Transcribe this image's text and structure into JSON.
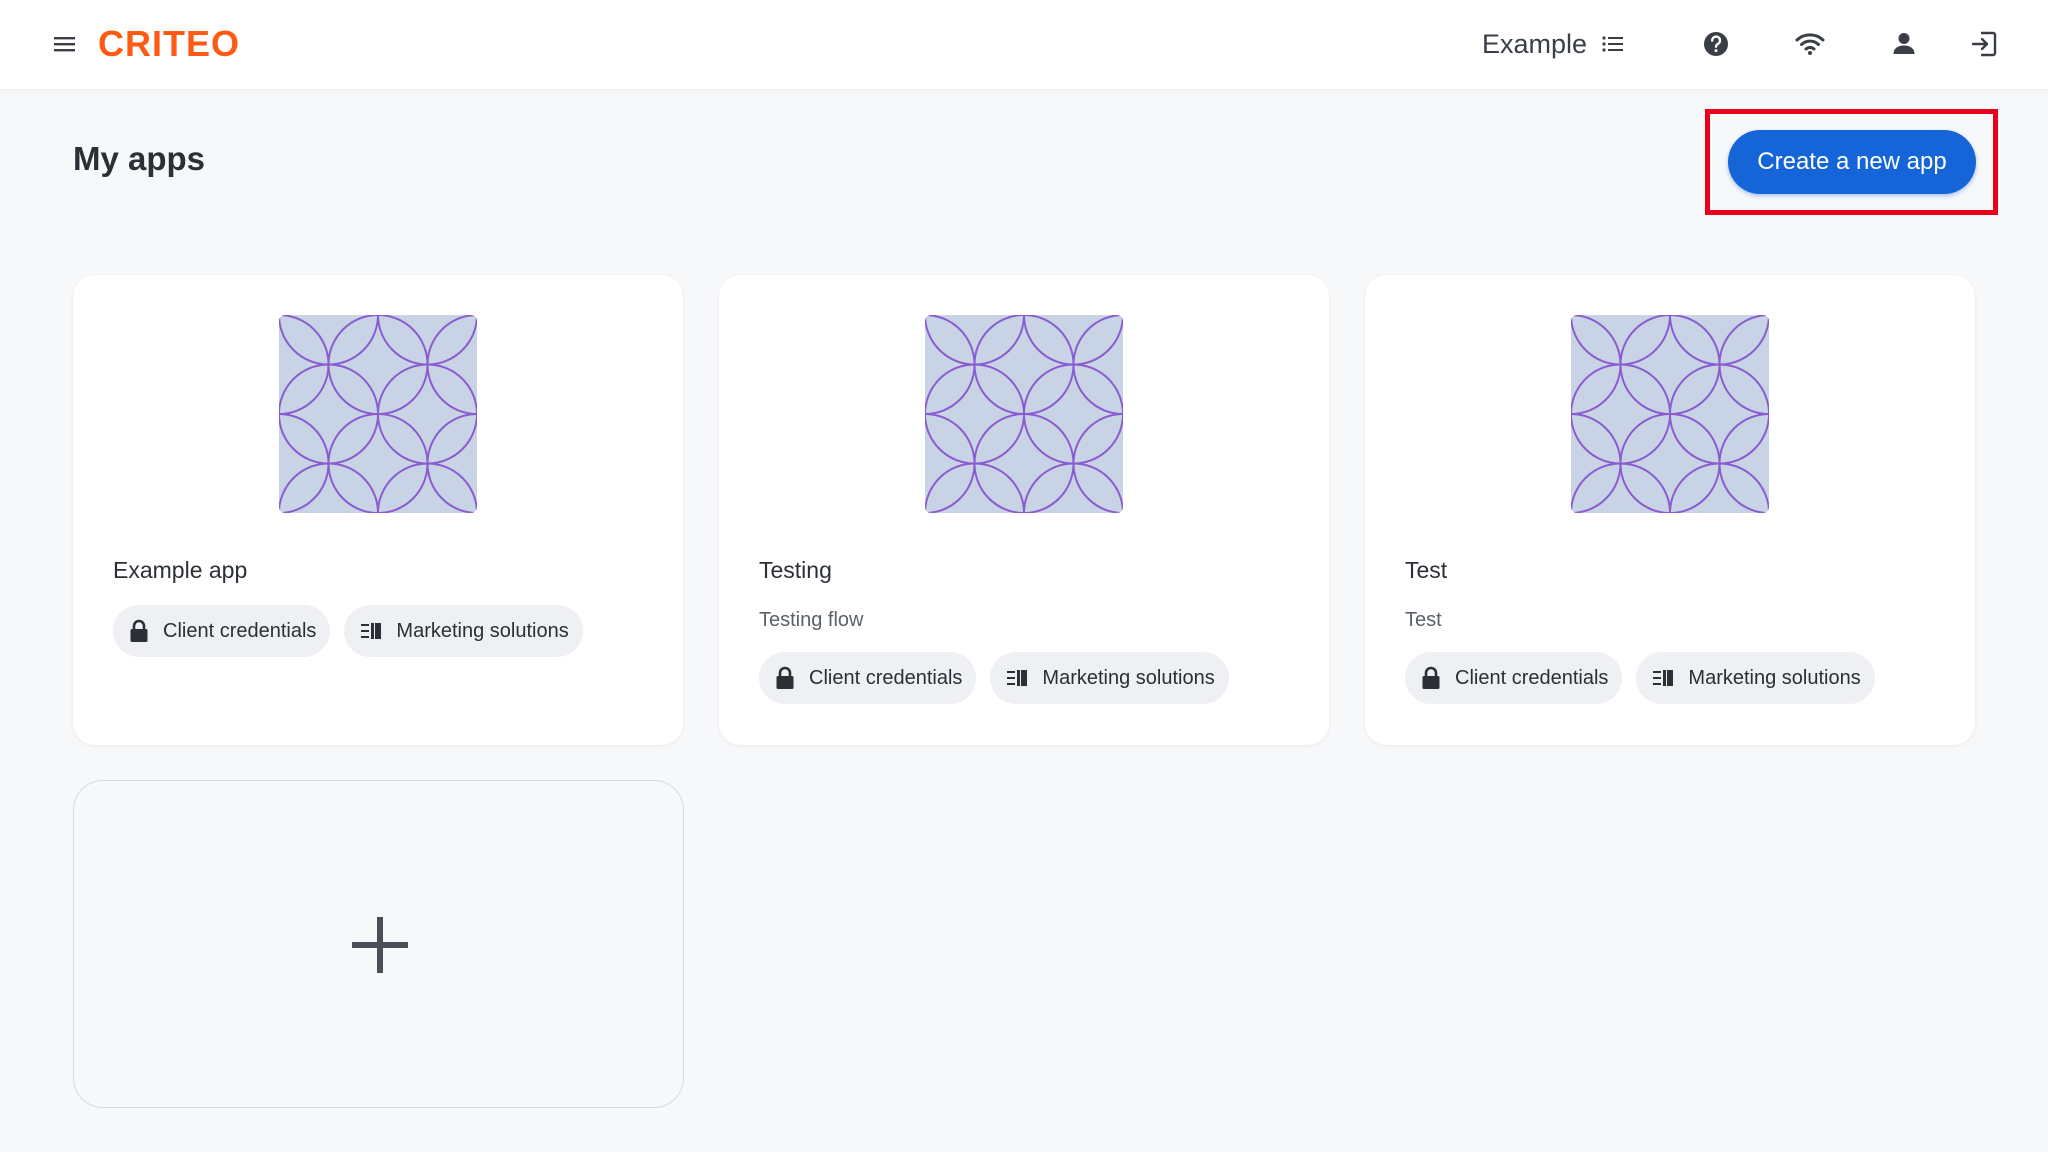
{
  "header": {
    "logo_text": "CRITEO",
    "account_name": "Example",
    "icons": [
      "menu-icon",
      "list-icon",
      "help-icon",
      "wifi-icon",
      "user-icon",
      "logout-icon"
    ]
  },
  "page": {
    "title": "My apps",
    "create_button_label": "Create a new app"
  },
  "apps": [
    {
      "name": "Example app",
      "description": "",
      "chips": [
        {
          "icon": "lock-icon",
          "label": "Client credentials"
        },
        {
          "icon": "marketing-icon",
          "label": "Marketing solutions"
        }
      ]
    },
    {
      "name": "Testing",
      "description": "Testing flow",
      "chips": [
        {
          "icon": "lock-icon",
          "label": "Client credentials"
        },
        {
          "icon": "marketing-icon",
          "label": "Marketing solutions"
        }
      ]
    },
    {
      "name": "Test",
      "description": "Test",
      "chips": [
        {
          "icon": "lock-icon",
          "label": "Client credentials"
        },
        {
          "icon": "marketing-icon",
          "label": "Marketing solutions"
        }
      ]
    }
  ],
  "colors": {
    "brand": "#ff5a14",
    "primary": "#1565d8",
    "highlight": "#e8001c",
    "art_bg": "#c8d4e6",
    "art_stroke": "#8a5cd0"
  }
}
